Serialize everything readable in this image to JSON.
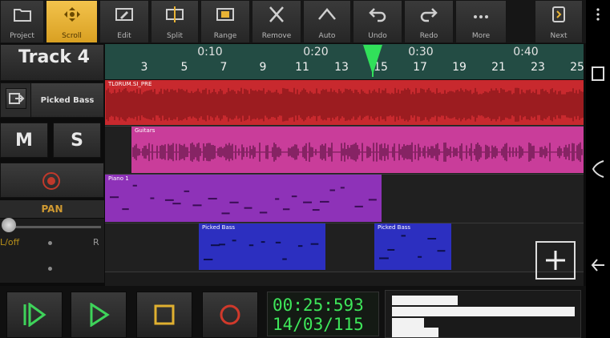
{
  "toolbar": {
    "items": [
      {
        "label": "Project",
        "icon": "folder-icon",
        "active": false
      },
      {
        "label": "Scroll",
        "icon": "move-icon",
        "active": true
      },
      {
        "label": "Edit",
        "icon": "edit-icon",
        "active": false
      },
      {
        "label": "Split",
        "icon": "split-icon",
        "active": false
      },
      {
        "label": "Range",
        "icon": "range-icon",
        "active": false
      },
      {
        "label": "Remove",
        "icon": "remove-icon",
        "active": false
      },
      {
        "label": "Auto",
        "icon": "automation-icon",
        "active": false
      },
      {
        "label": "Undo",
        "icon": "undo-icon",
        "active": false
      },
      {
        "label": "Redo",
        "icon": "redo-icon",
        "active": false
      },
      {
        "label": "More",
        "icon": "more-icon",
        "active": false
      },
      {
        "label": "Next",
        "icon": "next-icon",
        "active": false
      }
    ]
  },
  "track": {
    "name": "Track 4",
    "instrument": "Picked Bass",
    "mute_label": "M",
    "solo_label": "S",
    "pan_label": "PAN",
    "pan_off": "L/off",
    "pan_right": "R"
  },
  "timeline": {
    "major_ticks": [
      "0:10",
      "0:20",
      "0:30",
      "0:40"
    ],
    "minor_ticks": [
      "3",
      "5",
      "7",
      "9",
      "11",
      "13",
      "15",
      "17",
      "19",
      "21",
      "23",
      "25"
    ]
  },
  "clips": [
    {
      "lane": 0,
      "name": "TL0RUM.SI_PRE",
      "color": "#c8292e"
    },
    {
      "lane": 1,
      "name": "Guitars",
      "color": "#c93d9a"
    },
    {
      "lane": 2,
      "name": "Piano 1",
      "color": "#8e32b8"
    },
    {
      "lane": 3,
      "name": "Picked Bass",
      "color": "#2c2fc0"
    },
    {
      "lane": 3,
      "name": "Picked Bass",
      "color": "#2c2fc0"
    }
  ],
  "transport": {
    "time": "00:25:593",
    "position": "14/03/115"
  },
  "colors": {
    "accent": "#e8b335",
    "ruler": "#234c44",
    "playhead": "#31e05a",
    "time_text": "#3ee65a"
  }
}
